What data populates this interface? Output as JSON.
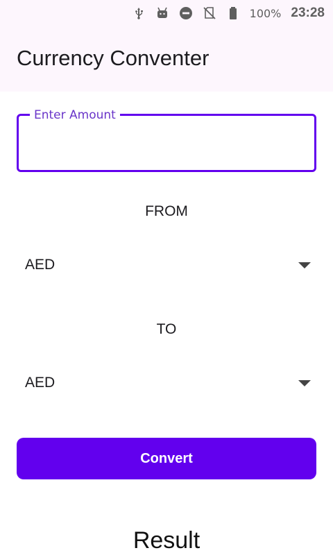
{
  "status_bar": {
    "icons": [
      "usb-icon",
      "android-debug-icon",
      "do-not-disturb-icon",
      "no-sim-icon",
      "battery-icon"
    ],
    "battery": "100%",
    "time": "23:28"
  },
  "app_bar": {
    "title": "Currency Conventer"
  },
  "amount": {
    "label": "Enter Amount",
    "value": ""
  },
  "from": {
    "label": "FROM",
    "selected": "AED"
  },
  "to": {
    "label": "TO",
    "selected": "AED"
  },
  "convert_button": {
    "label": "Convert"
  },
  "result": {
    "text": "Result"
  },
  "colors": {
    "accent": "#6200ee",
    "app_bar_bg": "#fdf6fd"
  }
}
